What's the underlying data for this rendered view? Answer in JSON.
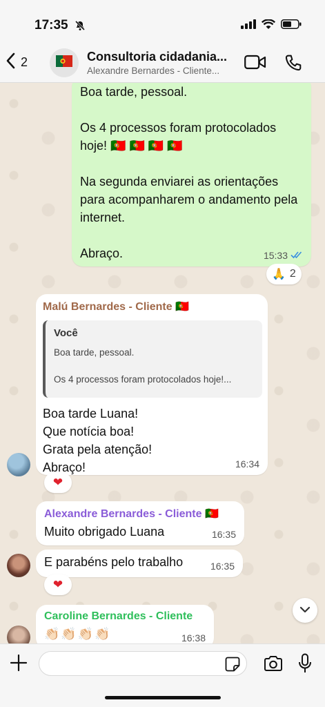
{
  "status": {
    "time": "17:35"
  },
  "header": {
    "back_count": "2",
    "title": "Consultoria cidadania...",
    "subtitle": "Alexandre Bernardes - Cliente..."
  },
  "messages": {
    "outgoing": {
      "text": "Boa tarde, pessoal.\n\nOs 4 processos foram protocolados hoje! 🇵🇹 🇵🇹 🇵🇹 🇵🇹\n\nNa segunda enviarei as orientações para acompanharem o andamento pela internet.\n\nAbraço.",
      "time": "15:33",
      "reaction_emoji": "🙏",
      "reaction_count": "2"
    },
    "malu": {
      "sender": "Malú Bernardes - Cliente 🇵🇹",
      "sender_color": "#a0694a",
      "quote_author": "Você",
      "quote_line1": "Boa tarde, pessoal.",
      "quote_line2": "Os 4 processos foram protocolados hoje!...",
      "text": "Boa tarde Luana!\nQue notícia boa!\nGrata pela atenção!\nAbraço!",
      "time": "16:34",
      "reaction": "❤"
    },
    "alexandre1": {
      "sender": "Alexandre Bernardes - Cliente 🇵🇹",
      "sender_color": "#8a5cd8",
      "text": "Muito obrigado Luana",
      "time": "16:35"
    },
    "alexandre2": {
      "text": "E parabéns pelo trabalho",
      "time": "16:35",
      "reaction": "❤"
    },
    "caroline": {
      "sender": "Caroline Bernardes - Cliente",
      "sender_color": "#2fbf5b",
      "text": "👏🏻👏🏻👏🏻👏🏻",
      "time": "16:38"
    }
  },
  "colors": {
    "outgoing_bubble": "#d6f8c9",
    "read_ticks": "#3a8fe0"
  }
}
